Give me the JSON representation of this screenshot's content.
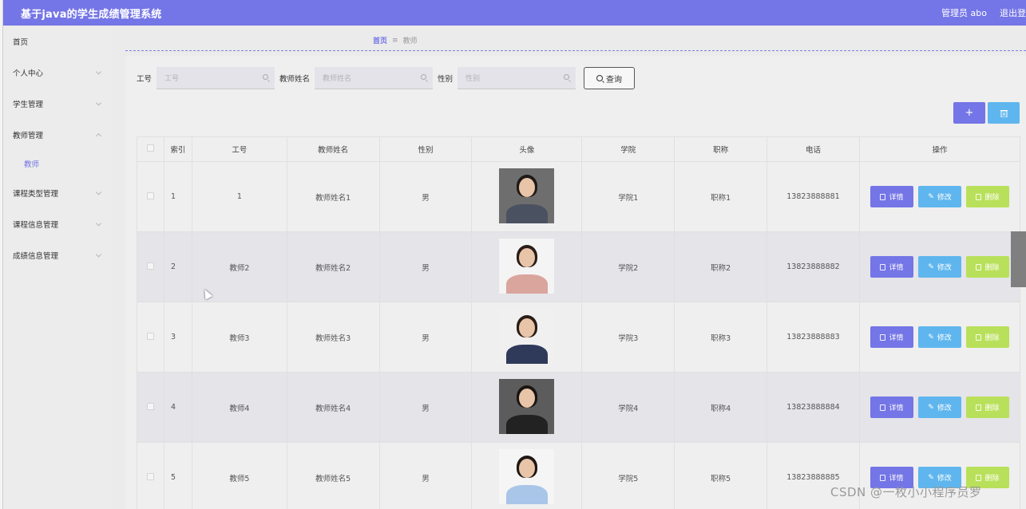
{
  "header": {
    "title": "基于java的学生成绩管理系统",
    "user_label": "管理员 abo",
    "logout_label": "退出登"
  },
  "sidebar": {
    "items": [
      {
        "label": "首页",
        "expandable": false
      },
      {
        "label": "个人中心",
        "expandable": true
      },
      {
        "label": "学生管理",
        "expandable": true
      },
      {
        "label": "教师管理",
        "expandable": true,
        "expanded": true
      },
      {
        "label": "教师",
        "sub": true
      },
      {
        "label": "课程类型管理",
        "expandable": true
      },
      {
        "label": "课程信息管理",
        "expandable": true
      },
      {
        "label": "成绩信息管理",
        "expandable": true
      }
    ]
  },
  "breadcrumb": {
    "home": "首页",
    "separator": "≡",
    "current": "教师"
  },
  "search": {
    "fields": [
      {
        "label": "工号",
        "placeholder": "工号"
      },
      {
        "label": "教师姓名",
        "placeholder": "教师姓名"
      },
      {
        "label": "性别",
        "placeholder": "性别"
      }
    ],
    "button_label": "查询"
  },
  "toolbar": {
    "add_label": "+",
    "delete_icon": "trash-icon"
  },
  "table": {
    "columns": [
      "索引",
      "工号",
      "教师姓名",
      "性别",
      "头像",
      "学院",
      "职称",
      "电话",
      "操作"
    ],
    "rows": [
      {
        "index": "1",
        "id": "1",
        "name": "教师姓名1",
        "gender": "男",
        "college": "学院1",
        "title": "职称1",
        "phone": "13823888881",
        "avatar": "man-suit"
      },
      {
        "index": "2",
        "id": "教师2",
        "name": "教师姓名2",
        "gender": "男",
        "college": "学院2",
        "title": "职称2",
        "phone": "13823888882",
        "avatar": "woman-pink"
      },
      {
        "index": "3",
        "id": "教师3",
        "name": "教师姓名3",
        "gender": "男",
        "college": "学院3",
        "title": "职称3",
        "phone": "13823888883",
        "avatar": "woman-navy"
      },
      {
        "index": "4",
        "id": "教师4",
        "name": "教师姓名4",
        "gender": "男",
        "college": "学院4",
        "title": "职称4",
        "phone": "13823888884",
        "avatar": "woman-black"
      },
      {
        "index": "5",
        "id": "教师5",
        "name": "教师姓名5",
        "gender": "男",
        "college": "学院5",
        "title": "职称5",
        "phone": "13823888885",
        "avatar": "woman-blue"
      }
    ],
    "actions": {
      "detail": "详情",
      "edit": "修改",
      "delete": "删除"
    }
  },
  "watermark": "CSDN @一枚小小程序员罗",
  "colors": {
    "accent": "#7475e6",
    "edit": "#5fb6ee",
    "delete": "#b9e05a"
  }
}
